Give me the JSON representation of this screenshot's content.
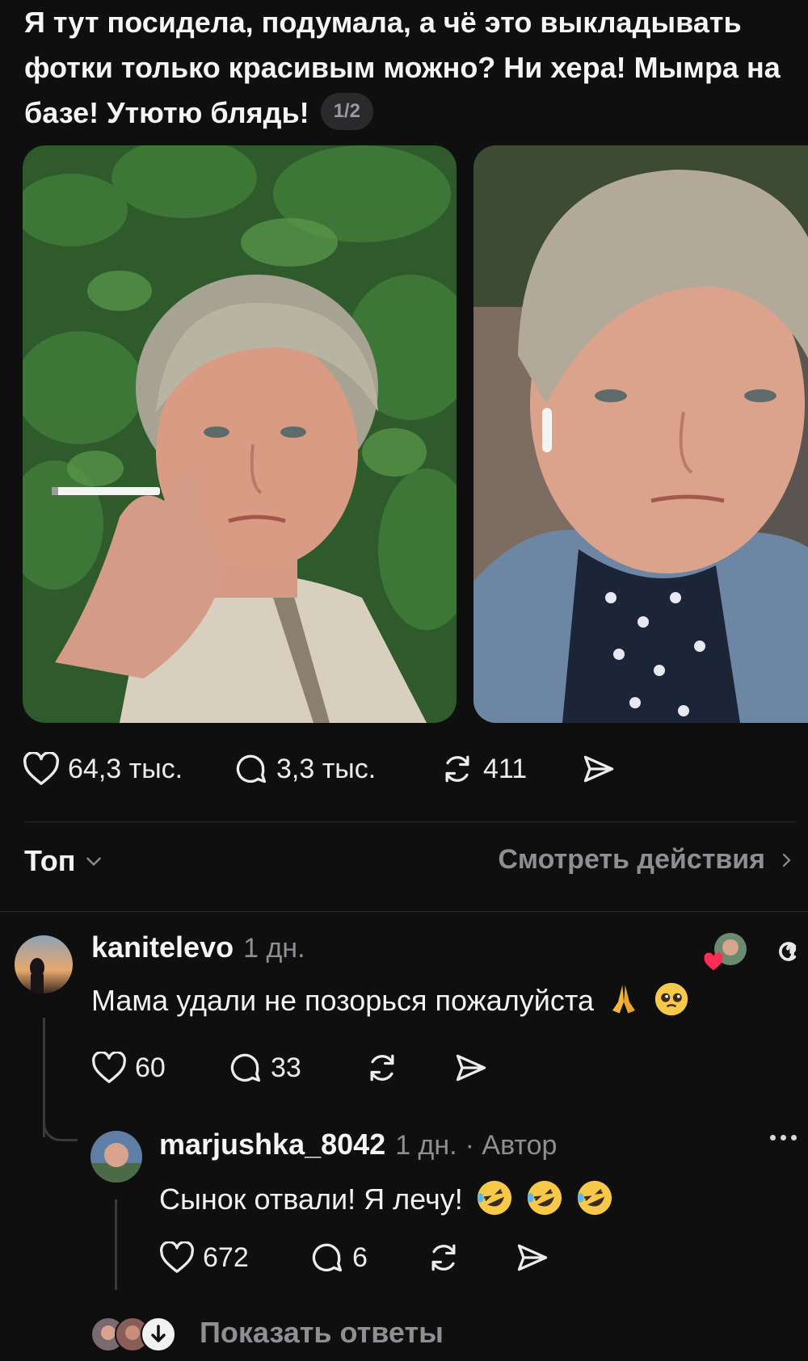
{
  "post": {
    "text": "Я тут посидела, подумала, а чё это выкладывать фотки только красивым можно? Ни хера! Мымра на базе! Утютю блядь!",
    "image_counter": "1/2",
    "likes": "64,3 тыс.",
    "comments": "3,3 тыс.",
    "reposts": "411"
  },
  "sort": {
    "label": "Топ",
    "activity_link": "Смотреть действия"
  },
  "comment1": {
    "username": "kanitelevo",
    "time": "1 дн.",
    "text": "Мама удали не позорься пожалуйста",
    "likes": "60",
    "replies": "33"
  },
  "comment2": {
    "username": "marjushka_8042",
    "time": "1 дн.",
    "author_badge": "· Автор",
    "text": "Сынок отвали! Я лечу!",
    "likes": "672",
    "replies": "6"
  },
  "show_replies": "Показать ответы",
  "colors": {
    "background": "#0f0f10",
    "text": "#f3f3f3",
    "secondary": "#8e8e93",
    "heart_red": "#ff2d55"
  }
}
